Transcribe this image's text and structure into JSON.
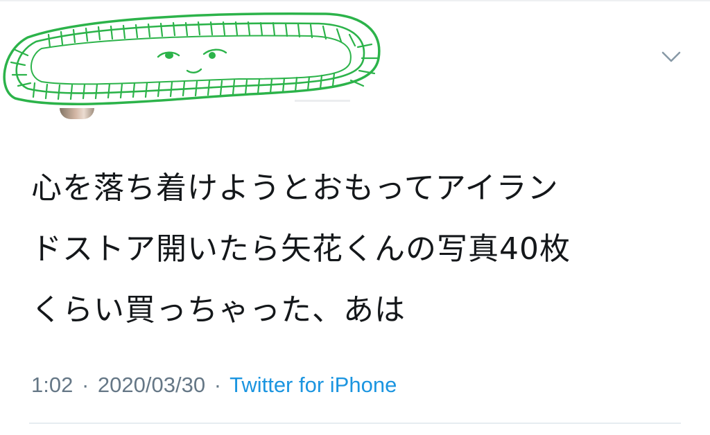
{
  "tweet": {
    "text_line1": "心を落ち着けようとおもってアイラン",
    "text_line2": "ドストア開いたら矢花くんの写真40枚",
    "text_line3": "くらい買っちゃった、あは",
    "time": "1:02",
    "date": "2020/03/30",
    "separator": "·",
    "source": "Twitter for iPhone"
  },
  "icons": {
    "caret": "chevron-down-icon",
    "scribble": "green-hand-drawn-censor-scribble"
  },
  "colors": {
    "text": "#14171a",
    "meta": "#657786",
    "link": "#1b95e0",
    "scribble": "#2cb34a",
    "divider": "#e6ecf0",
    "caret": "#8899a6"
  }
}
